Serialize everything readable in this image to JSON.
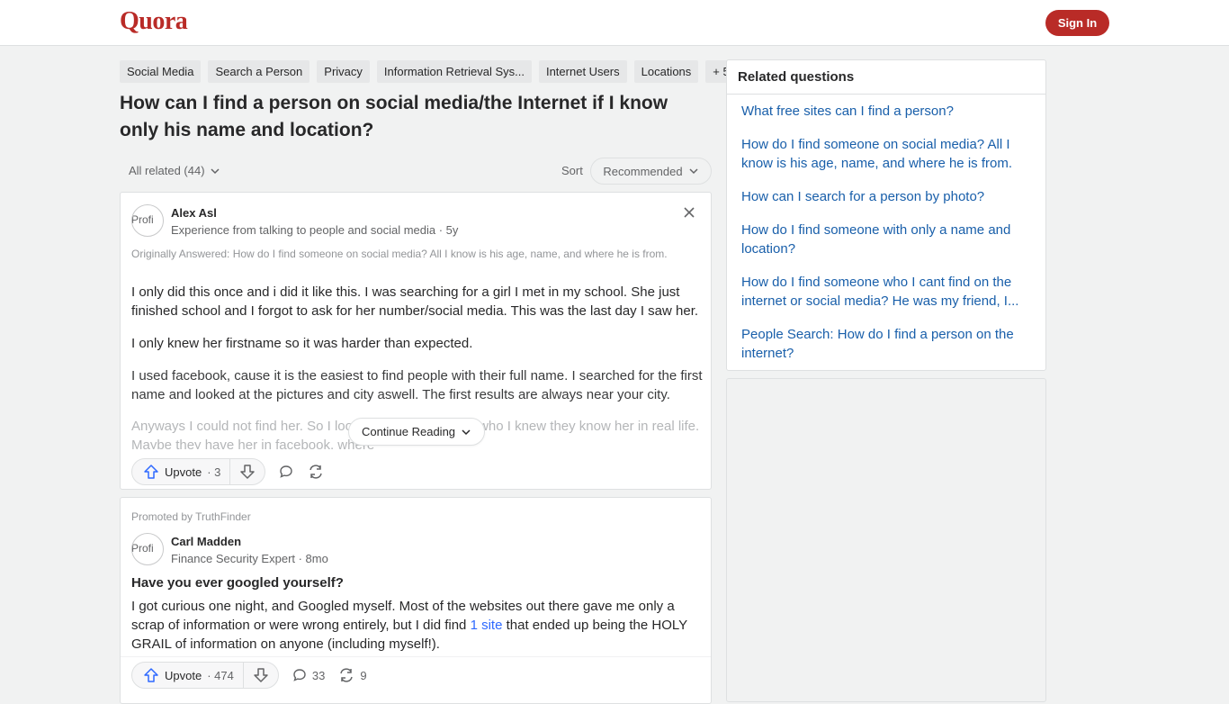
{
  "header": {
    "logo": "Quora",
    "signin_label": "Sign In"
  },
  "topics": [
    "Social Media",
    "Search a Person",
    "Privacy",
    "Information Retrieval Sys...",
    "Internet Users",
    "Locations",
    "+ 5"
  ],
  "question": {
    "title": "How can I find a person on social media/the Internet if I know only his name and location?"
  },
  "filters": {
    "all_related": "All related (44)",
    "sort_label": "Sort",
    "sort_value": "Recommended"
  },
  "answer": {
    "avatar_alt": "Profi",
    "author": "Alex Asl",
    "credential": "Experience from talking to people and social media · 5y",
    "originally_answered": "Originally Answered: How do I find someone on social media? All I know is his age, name, and where he is from.",
    "paragraphs": [
      "I only did this once and i did it like this. I was searching for a girl I met in my school. She just finished school and I forgot to ask for her number/social media. This was the last day I saw her.",
      "I only knew her firstname so it was harder than expected.",
      "I used facebook, cause it is the easiest to find people with their full name. I searched for the first name and looked at the pictures and city aswell. The first results are always near your city.",
      "Anyways I could not find her. So I looked for a lot of peopl,who I knew they know her in real life. Maybe they have her in facebook, where"
    ],
    "continue_label": "Continue Reading",
    "upvote_label": "Upvote",
    "upvote_count": "· 3"
  },
  "promoted": {
    "promoted_by": "Promoted by TruthFinder",
    "avatar_alt": "Profi",
    "author": "Carl Madden",
    "credential": "Finance Security Expert · 8mo",
    "title": "Have you ever googled yourself?",
    "body_before": "I got curious one night, and Googled myself. Most of the websites out there gave me only a scrap of information or were wrong entirely, but I did find ",
    "link_text": "1 site",
    "body_after": " that ended up being the HOLY GRAIL of information on anyone (including myself!).",
    "upvote_label": "Upvote",
    "upvote_count": "· 474",
    "comments": "33",
    "shares": "9"
  },
  "related": {
    "heading": "Related questions",
    "items": [
      "What free sites can I find a person?",
      "How do I find someone on social media? All I know is his age, name, and where he is from.",
      "How can I search for a person by photo?",
      "How do I find someone with only a name and location?",
      "How do I find someone who I cant find on the internet or social media? He was my friend, I...",
      "People Search: How do I find a person on the internet?"
    ]
  },
  "colors": {
    "brand": "#b92b27",
    "link": "#195faa",
    "upvote": "#2e69ff"
  }
}
